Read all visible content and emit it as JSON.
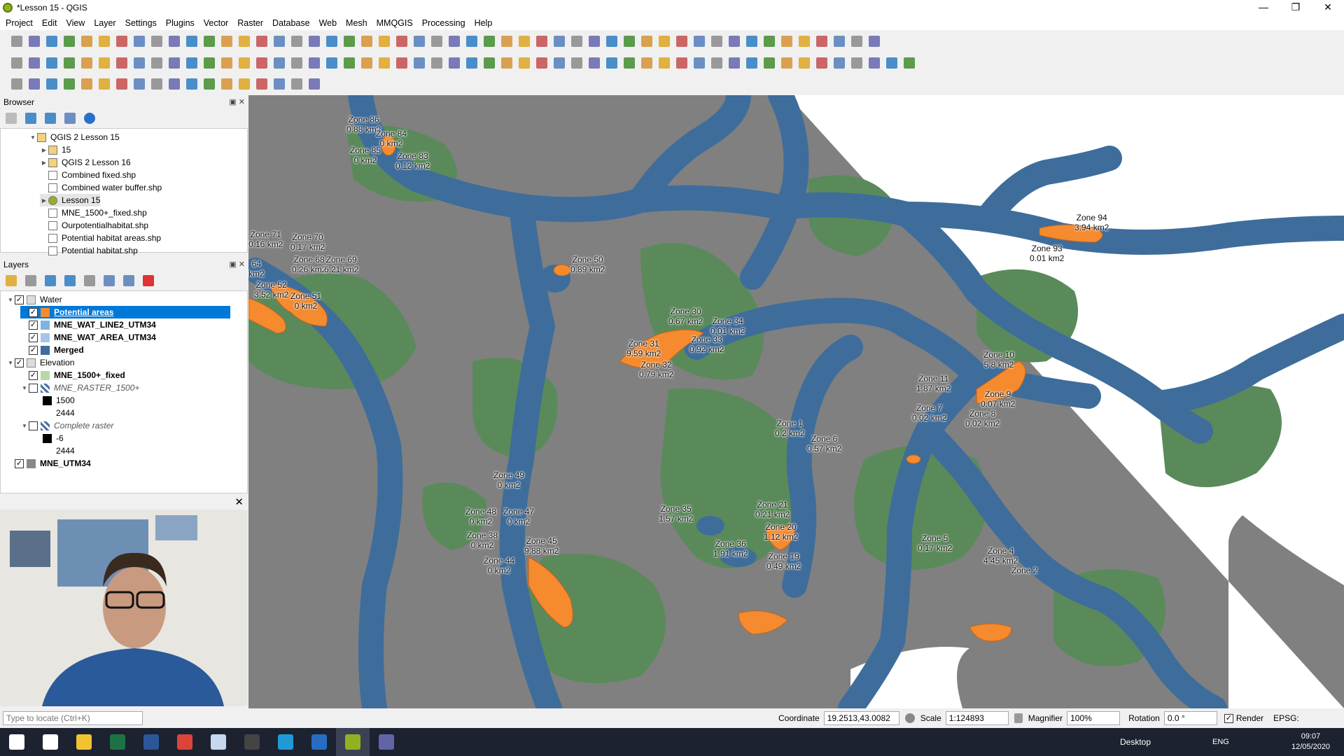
{
  "window": {
    "title": "*Lesson 15 - QGIS",
    "controls": [
      "—",
      "❐",
      "✕"
    ]
  },
  "menu": [
    "Project",
    "Edit",
    "View",
    "Layer",
    "Settings",
    "Plugins",
    "Vector",
    "Raster",
    "Database",
    "Web",
    "Mesh",
    "MMQGIS",
    "Processing",
    "Help"
  ],
  "browser": {
    "title": "Browser",
    "items": [
      {
        "label": "QGIS 2 Lesson 15",
        "level": 0,
        "caret": "▼",
        "icon": "folder-icon"
      },
      {
        "label": "15",
        "level": 1,
        "caret": "▶",
        "icon": "folder-icon"
      },
      {
        "label": "QGIS 2 Lesson 16",
        "level": 1,
        "caret": "▶",
        "icon": "folder-icon"
      },
      {
        "label": "Combined fixed.shp",
        "level": 1,
        "caret": "",
        "icon": "polygon-layer-icon"
      },
      {
        "label": "Combined water buffer.shp",
        "level": 1,
        "caret": "",
        "icon": "polygon-layer-icon"
      },
      {
        "label": "Lesson 15",
        "level": 1,
        "caret": "▶",
        "icon": "qgis-project-icon"
      },
      {
        "label": "MNE_1500+_fixed.shp",
        "level": 1,
        "caret": "",
        "icon": "polygon-layer-icon"
      },
      {
        "label": "Ourpotentialhabitat.shp",
        "level": 1,
        "caret": "",
        "icon": "polygon-layer-icon"
      },
      {
        "label": "Potential habitat areas.shp",
        "level": 1,
        "caret": "",
        "icon": "polygon-layer-icon"
      },
      {
        "label": "Potential habitat.shp",
        "level": 1,
        "caret": "",
        "icon": "polygon-layer-icon"
      }
    ]
  },
  "layers": {
    "title": "Layers",
    "items": [
      {
        "label": "Water",
        "level": 0,
        "caret": "▼",
        "checked": true,
        "group": true,
        "style": "",
        "color": ""
      },
      {
        "label": "Potential areas",
        "level": 1,
        "caret": "",
        "checked": true,
        "selected": true,
        "style": "bold",
        "color": "#f58a2e"
      },
      {
        "label": "MNE_WAT_LINE2_UTM34",
        "level": 1,
        "caret": "",
        "checked": true,
        "style": "bold",
        "color": "#7fb3e0"
      },
      {
        "label": "MNE_WAT_AREA_UTM34",
        "level": 1,
        "caret": "",
        "checked": true,
        "style": "bold",
        "color": "#a7c4e6"
      },
      {
        "label": "Merged",
        "level": 1,
        "caret": "",
        "checked": true,
        "style": "bold",
        "color": "#3e6d9c"
      },
      {
        "label": "Elevation",
        "level": 0,
        "caret": "▼",
        "checked": true,
        "group": true,
        "style": "",
        "color": ""
      },
      {
        "label": "MNE_1500+_fixed",
        "level": 1,
        "caret": "",
        "checked": true,
        "style": "bold",
        "color": "#b5d9a7"
      },
      {
        "label": "MNE_RASTER_1500+",
        "level": 1,
        "caret": "▼",
        "checked": false,
        "style": "ital",
        "color": "raster"
      },
      {
        "label": "1500",
        "level": 2,
        "caret": "",
        "checked": null,
        "style": "",
        "color": "#000000"
      },
      {
        "label": "2444",
        "level": 2,
        "caret": "",
        "checked": null,
        "style": "",
        "color": ""
      },
      {
        "label": "Complete raster",
        "level": 1,
        "caret": "▼",
        "checked": false,
        "style": "ital",
        "color": "raster"
      },
      {
        "label": "-6",
        "level": 2,
        "caret": "",
        "checked": null,
        "style": "",
        "color": "#000000"
      },
      {
        "label": "2444",
        "level": 2,
        "caret": "",
        "checked": null,
        "style": "",
        "color": ""
      },
      {
        "label": "MNE_UTM34",
        "level": 0,
        "caret": "",
        "checked": true,
        "style": "bold",
        "color": "#888888"
      }
    ]
  },
  "map_labels": [
    {
      "t": "Zone 86\n0.88 km2"
    },
    {
      "t": "Zone 84\n0 km2"
    },
    {
      "t": "Zone 85\n0 km2"
    },
    {
      "t": "Zone 83\n0.12 km2"
    },
    {
      "t": "Zone 71\n0.16 km2"
    },
    {
      "t": "Zone 70\n0.17 km2"
    },
    {
      "t": "Zone 68\n0.26 km2"
    },
    {
      "t": "Zone 69\n6.21 km2"
    },
    {
      "t": "64\nkm2"
    },
    {
      "t": "Zone 52\n3.52 km2"
    },
    {
      "t": "Zone 51\n0 km2"
    },
    {
      "t": "Zone 50\n0.89 km2"
    },
    {
      "t": "Zone 30\n0.67 km2"
    },
    {
      "t": "Zone 34\n0.01 km2"
    },
    {
      "t": "Zone 31\n9.59 km2"
    },
    {
      "t": "Zone 33\n0.92 km2"
    },
    {
      "t": "Zone 32\n0.79 km2"
    },
    {
      "t": "Zone 94\n3.94 km2"
    },
    {
      "t": "Zone 93\n0.01 km2"
    },
    {
      "t": "Zone 10\n5.8 km2"
    },
    {
      "t": "Zone 11\n1.87 km2"
    },
    {
      "t": "Zone 9\n0.07 km2"
    },
    {
      "t": "Zone 7\n0.02 km2"
    },
    {
      "t": "Zone 8\n0.02 km2"
    },
    {
      "t": "Zone 1\n0.2 km2"
    },
    {
      "t": "Zone 6\n0.57 km2"
    },
    {
      "t": "Zone 49\n0 km2"
    },
    {
      "t": "Zone 48\n0 km2"
    },
    {
      "t": "Zone 47\n0 km2"
    },
    {
      "t": "Zone 35\n1.57 km2"
    },
    {
      "t": "Zone 21\n0.21 km2"
    },
    {
      "t": "Zone 20\n1.12 km2"
    },
    {
      "t": "Zone 38\n0 km2"
    },
    {
      "t": "Zone 45\n9.88 km2"
    },
    {
      "t": "Zone 36\n1.91 km2"
    },
    {
      "t": "Zone 19\n0.49 km2"
    },
    {
      "t": "Zone 5\n0.17 km2"
    },
    {
      "t": "Zone 4\n4.45 km2"
    },
    {
      "t": "Zone 44\n0 km2"
    },
    {
      "t": "Zone 2"
    }
  ],
  "status": {
    "locate_placeholder": "Type to locate (Ctrl+K)",
    "coordinate_label": "Coordinate",
    "coordinate_value": "19.2513,43.0082",
    "scale_label": "Scale",
    "scale_value": "1:124893",
    "magnifier_label": "Magnifier",
    "magnifier_value": "100%",
    "rotation_label": "Rotation",
    "rotation_value": "0.0 °",
    "render_label": "Render",
    "crs_label": "EPSG:"
  },
  "taskbar": {
    "desktop_label": "Desktop",
    "language": "ENG",
    "time": "09:07",
    "date": "12/05/2020",
    "apps": [
      {
        "name": "windows-start-icon",
        "color": "#ffffff"
      },
      {
        "name": "task-view-icon",
        "color": "#ffffff"
      },
      {
        "name": "file-explorer-icon",
        "color": "#f1c232"
      },
      {
        "name": "excel-icon",
        "color": "#1e7145"
      },
      {
        "name": "word-icon",
        "color": "#2b579a"
      },
      {
        "name": "chrome-icon",
        "color": "#db4437"
      },
      {
        "name": "notepad-icon",
        "color": "#c7d8ee"
      },
      {
        "name": "calculator-icon",
        "color": "#444"
      },
      {
        "name": "edge-icon",
        "color": "#1f9ad6"
      },
      {
        "name": "r-icon",
        "color": "#276dc3"
      },
      {
        "name": "qgis-icon",
        "color": "#93b023"
      },
      {
        "name": "teams-icon",
        "color": "#6264a7"
      }
    ]
  },
  "colors": {
    "water": "#3e6d9c",
    "vegetation": "#5a8a5a",
    "land": "#808080",
    "potential": "#f58a2e",
    "selection": "#0078d7"
  }
}
